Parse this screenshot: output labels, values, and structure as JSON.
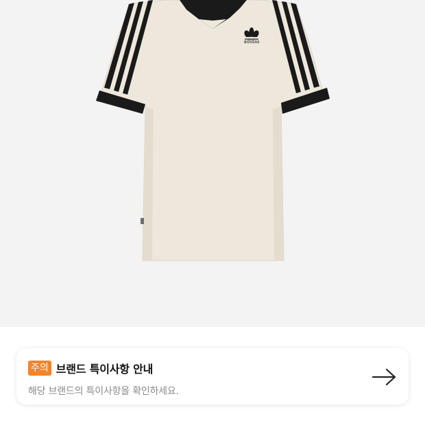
{
  "product": {
    "image_icon": "polo-shirt-image",
    "logo_text": "adidas"
  },
  "notice": {
    "badge": "주의",
    "title": "브랜드 특이사항 안내",
    "description": "해당 브랜드의 특이사항을 확인하세요.",
    "arrow_icon": "arrow-right-icon",
    "badge_color": "#f2852b"
  }
}
